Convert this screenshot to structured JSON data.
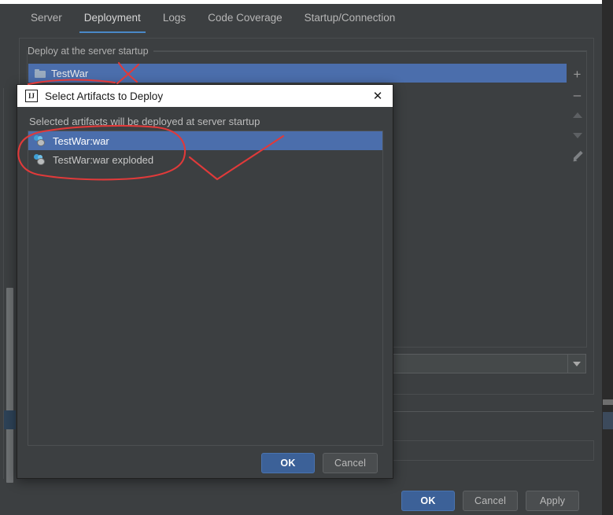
{
  "window": {
    "tabs": [
      {
        "label": "Server",
        "active": false
      },
      {
        "label": "Deployment",
        "active": true
      },
      {
        "label": "Logs",
        "active": false
      },
      {
        "label": "Code Coverage",
        "active": false
      },
      {
        "label": "Startup/Connection",
        "active": false
      }
    ],
    "deploy_group_label": "Deploy at the server startup",
    "deploy_list": [
      {
        "label": "TestWar",
        "icon": "folder-icon",
        "selected": true
      }
    ],
    "toolbar": [
      {
        "name": "add-button",
        "icon": "plus-icon",
        "glyph": "+"
      },
      {
        "name": "remove-button",
        "icon": "minus-icon",
        "glyph": "–"
      },
      {
        "name": "move-up-button",
        "icon": "triangle-up-icon"
      },
      {
        "name": "move-down-button",
        "icon": "triangle-down-icon"
      },
      {
        "name": "edit-button",
        "icon": "pencil-icon"
      }
    ],
    "combo": {
      "value": "",
      "icon": "chevron-down-icon"
    },
    "buttons": {
      "ok": "OK",
      "cancel": "Cancel",
      "apply": "Apply"
    }
  },
  "dialog": {
    "title": "Select Artifacts to Deploy",
    "app_icon_text": "IJ",
    "close_icon": "✕",
    "subtitle": "Selected artifacts will be deployed at server startup",
    "artifacts": [
      {
        "label": "TestWar:war",
        "selected": true
      },
      {
        "label": "TestWar:war exploded",
        "selected": false
      }
    ],
    "buttons": {
      "ok": "OK",
      "cancel": "Cancel"
    }
  },
  "annotations": {
    "color": "#e03a3a",
    "marks": [
      {
        "name": "cross-mark-over-testwar"
      },
      {
        "name": "underline-under-testwar"
      },
      {
        "name": "circle-around-artifact-list"
      },
      {
        "name": "arrow-pointing-to-selected-artifact"
      }
    ]
  },
  "colors": {
    "background": "#3c3f41",
    "selection_blue": "#4b6eac",
    "accent_tab": "#4a88c7",
    "button_default": "#3c6198",
    "annotation_red": "#e03a3a"
  }
}
